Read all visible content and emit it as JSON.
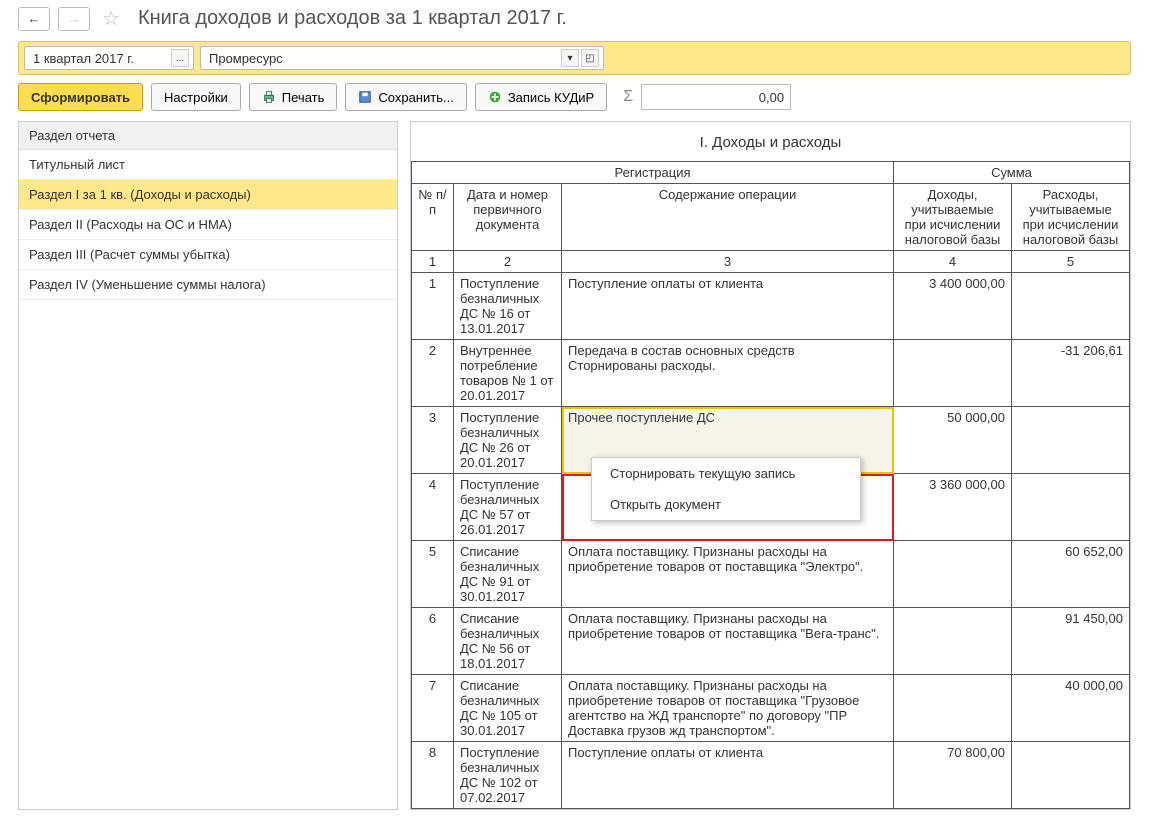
{
  "header": {
    "title": "Книга доходов и расходов за 1 квартал 2017 г."
  },
  "params": {
    "period": "1 квартал 2017 г.",
    "organization": "Промресурс"
  },
  "toolbar": {
    "generate": "Сформировать",
    "settings": "Настройки",
    "print": "Печать",
    "save": "Сохранить...",
    "kudir": "Запись КУДиР",
    "sum_value": "0,00"
  },
  "sidebar": {
    "header": "Раздел отчета",
    "items": [
      {
        "label": "Титульный лист",
        "active": false
      },
      {
        "label": "Раздел I за 1 кв. (Доходы и расходы)",
        "active": true
      },
      {
        "label": "Раздел II (Расходы на ОС и НМА)",
        "active": false
      },
      {
        "label": "Раздел III (Расчет суммы убытка)",
        "active": false
      },
      {
        "label": "Раздел IV (Уменьшение суммы налога)",
        "active": false
      }
    ]
  },
  "report": {
    "title": "I. Доходы и расходы",
    "header_group1": "Регистрация",
    "header_group2": "Сумма",
    "col_num": "№ п/п",
    "col_doc": "Дата и номер первичного документа",
    "col_op": "Содержание операции",
    "col_income": "Доходы, учитываемые при исчислении налоговой базы",
    "col_expense": "Расходы, учитываемые при исчислении налоговой базы",
    "colnums": [
      "1",
      "2",
      "3",
      "4",
      "5"
    ],
    "rows": [
      {
        "n": "1",
        "doc": "Поступление безналичных ДС № 16 от 13.01.2017",
        "op": "Поступление оплаты от клиента",
        "inc": "3 400 000,00",
        "exp": ""
      },
      {
        "n": "2",
        "doc": "Внутреннее потребление товаров № 1 от 20.01.2017",
        "op": "Передача в состав основных средств Сторнированы расходы.",
        "inc": "",
        "exp": "-31 206,61"
      },
      {
        "n": "3",
        "doc": "Поступление безналичных ДС № 26 от 20.01.2017",
        "op": "Прочее поступление ДС",
        "inc": "50 000,00",
        "exp": "",
        "hl": "yellow"
      },
      {
        "n": "4",
        "doc": "Поступление безналичных ДС № 57 от 26.01.2017",
        "op": "",
        "inc": "3 360 000,00",
        "exp": "",
        "hl": "red"
      },
      {
        "n": "5",
        "doc": "Списание безналичных ДС № 91 от 30.01.2017",
        "op": "Оплата поставщику. Признаны расходы на приобретение товаров от поставщика \"Электро\".",
        "inc": "",
        "exp": "60 652,00"
      },
      {
        "n": "6",
        "doc": "Списание безналичных ДС № 56 от 18.01.2017",
        "op": "Оплата поставщику. Признаны расходы на приобретение товаров от поставщика \"Вега-транс\".",
        "inc": "",
        "exp": "91 450,00"
      },
      {
        "n": "7",
        "doc": "Списание безналичных ДС № 105 от 30.01.2017",
        "op": "Оплата поставщику. Признаны расходы на приобретение товаров от поставщика \"Грузовое агентство на ЖД транспорте\" по договору \"ПР Доставка грузов жд транспортом\".",
        "inc": "",
        "exp": "40 000,00"
      },
      {
        "n": "8",
        "doc": "Поступление безналичных ДС № 102 от 07.02.2017",
        "op": "Поступление оплаты от клиента",
        "inc": "70 800,00",
        "exp": ""
      }
    ]
  },
  "context_menu": {
    "items": [
      "Сторнировать текущую запись",
      "Открыть документ"
    ]
  }
}
